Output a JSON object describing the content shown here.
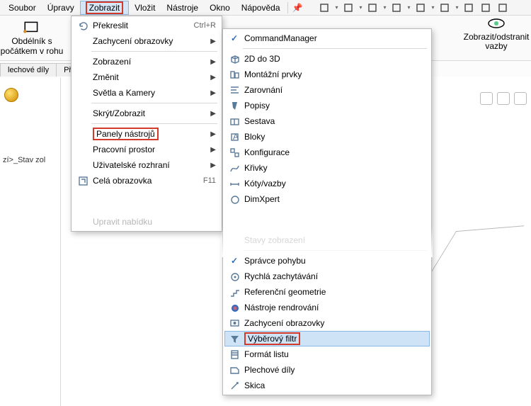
{
  "menubar": [
    "Soubor",
    "Úpravy",
    "Zobrazit",
    "Vložit",
    "Nástroje",
    "Okno",
    "Nápověda"
  ],
  "menubar_active_index": 2,
  "bigbuttons": {
    "left": "Obdélník s\npočátkem v rohu",
    "right": "Zobrazit/odstranit\nvazby"
  },
  "tabs": [
    "lechové díly",
    "Přín"
  ],
  "leftpanel_item": "zí>_Stav zol",
  "menu1": [
    {
      "t": "Překreslit",
      "i": "refresh",
      "sc": "Ctrl+R"
    },
    {
      "t": "Zachycení obrazovky",
      "sub": true
    },
    {
      "sep": true
    },
    {
      "t": "Zobrazení",
      "sub": true
    },
    {
      "t": "Změnit",
      "sub": true
    },
    {
      "t": "Světla a Kamery",
      "sub": true
    },
    {
      "sep": true
    },
    {
      "t": "Skrýt/Zobrazit",
      "sub": true
    },
    {
      "sep": true
    },
    {
      "t": "Panely nástrojů",
      "sub": true,
      "hl": true
    },
    {
      "t": "Pracovní prostor",
      "sub": true
    },
    {
      "t": "Uživatelské rozhraní",
      "sub": true
    },
    {
      "t": "Celá obrazovka",
      "i": "fullscreen",
      "sc": "F11"
    },
    {
      "gap": true
    },
    {
      "t": "Upravit nabídku",
      "dis": true
    }
  ],
  "menu2": [
    {
      "t": "CommandManager",
      "check": true
    },
    {
      "sep": true
    },
    {
      "t": "2D do 3D",
      "i": "cube"
    },
    {
      "t": "Montážní prvky",
      "i": "parts"
    },
    {
      "t": "Zarovnání",
      "i": "align"
    },
    {
      "t": "Popisy",
      "i": "note"
    },
    {
      "t": "Sestava",
      "i": "asm"
    },
    {
      "t": "Bloky",
      "i": "block"
    },
    {
      "t": "Konfigurace",
      "i": "cfg"
    },
    {
      "t": "Křivky",
      "i": "curve"
    },
    {
      "t": "Kóty/vazby",
      "i": "dim"
    },
    {
      "t": "DimXpert",
      "i": "dimx",
      "fade": true
    },
    {
      "gap": true
    },
    {
      "t": "Stavy zobrazení",
      "dis": true,
      "fade": true
    },
    {
      "sep": true
    },
    {
      "t": "Správce pohybu",
      "check": true
    },
    {
      "t": "Rychlá zachytávání",
      "i": "snap"
    },
    {
      "t": "Referenční geometrie",
      "i": "ref"
    },
    {
      "t": "Nástroje rendrování",
      "i": "render"
    },
    {
      "t": "Zachycení obrazovky",
      "i": "screen"
    },
    {
      "t": "Výběrový filtr",
      "i": "filter",
      "hl": true,
      "hov": true
    },
    {
      "t": "Formát listu",
      "i": "sheet"
    },
    {
      "t": "Plechové díly",
      "i": "sheetm"
    },
    {
      "t": "Skica",
      "i": "sketch"
    }
  ]
}
